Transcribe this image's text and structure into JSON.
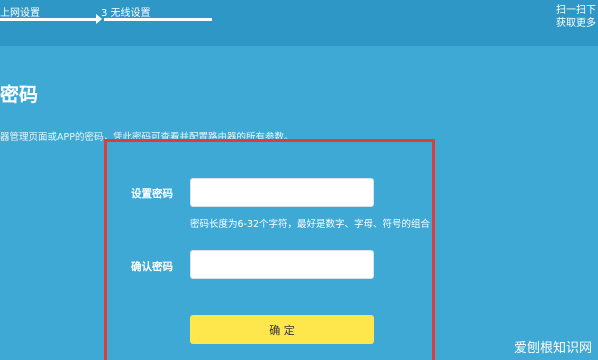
{
  "header": {
    "steps": [
      {
        "label": "上网设置"
      },
      {
        "label": "3 无线设置"
      }
    ],
    "scan_line1": "扫一扫下",
    "scan_line2": "获取更多"
  },
  "main": {
    "title": "密码",
    "description": "器管理页面或APP的密码，凭此密码可查看并配置路由器的所有参数。",
    "form": {
      "set_password_label": "设置密码",
      "set_password_value": "",
      "hint": "密码长度为6-32个字符，最好是数字、字母、符号的组合",
      "confirm_password_label": "确认密码",
      "confirm_password_value": "",
      "confirm_button": "确 定"
    }
  },
  "watermark": "爱刨根知识网",
  "colors": {
    "background": "#3fa9d6",
    "header": "#2f97c6",
    "highlight_border": "#e03a3a",
    "button": "#fde74c"
  }
}
